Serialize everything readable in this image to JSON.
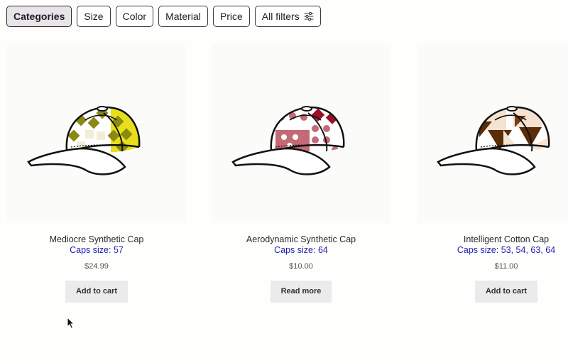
{
  "filters": [
    {
      "label": "Categories",
      "active": true
    },
    {
      "label": "Size",
      "active": false
    },
    {
      "label": "Color",
      "active": false
    },
    {
      "label": "Material",
      "active": false
    },
    {
      "label": "Price",
      "active": false
    },
    {
      "label": "All filters",
      "active": false,
      "icon": "sliders-icon"
    }
  ],
  "products": [
    {
      "title": "Mediocre Synthetic Cap",
      "caps_size": "Caps size: 57",
      "price": "$24.99",
      "button": "Add to cart",
      "colors": {
        "main": "#8a8a12",
        "light": "#f4ecd4",
        "accent": "#e8de1c"
      }
    },
    {
      "title": "Aerodynamic Synthetic Cap",
      "caps_size": "Caps size: 64",
      "price": "$10.00",
      "button": "Read more",
      "colors": {
        "main": "#c46a76",
        "light": "#ffffff",
        "accent": "#9c1028"
      }
    },
    {
      "title": "Intelligent Cotton Cap",
      "caps_size": "Caps size: 53, 54, 63, 64",
      "price": "$11.00",
      "button": "Add to cart",
      "colors": {
        "main": "#5a2c08",
        "light": "#f6e2d0",
        "accent": "#7a3e12"
      }
    }
  ]
}
